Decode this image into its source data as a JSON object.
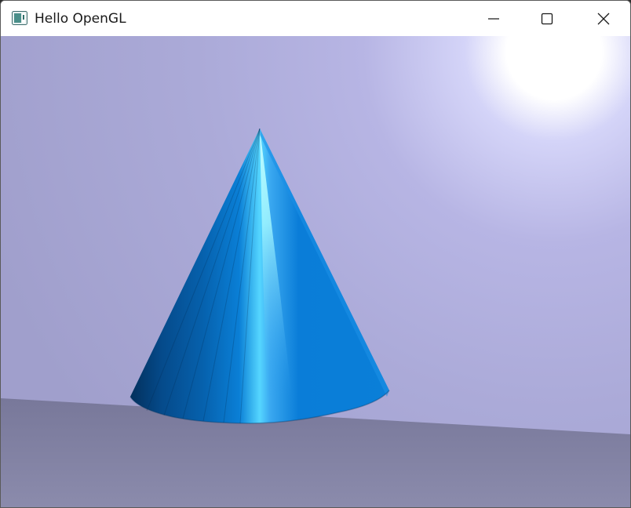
{
  "window": {
    "title": "Hello OpenGL",
    "icon": "opengl-app-icon",
    "controls": {
      "minimize_icon": "minimize-icon",
      "maximize_icon": "maximize-icon",
      "close_icon": "close-icon"
    }
  },
  "scene": {
    "object": "cone",
    "colors": {
      "wall": "#ababd6",
      "floor": "#8888a8",
      "cone_base": "#0a78d4",
      "cone_shadow": "#053d78",
      "cone_highlight": "#9ff5ff",
      "light": "#ffffff"
    }
  }
}
